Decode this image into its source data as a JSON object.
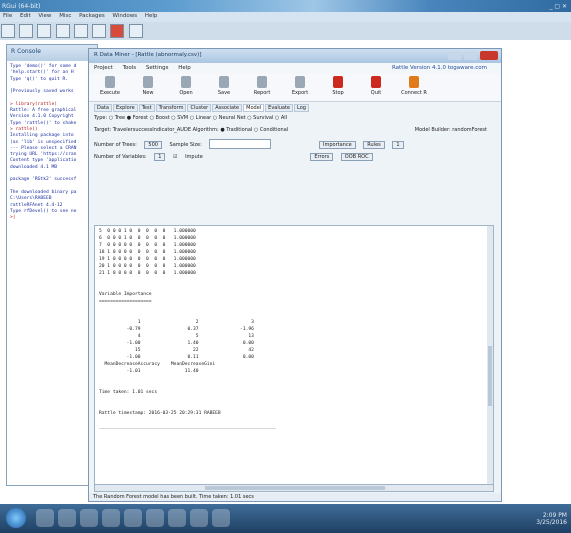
{
  "app": {
    "title": "RGui (64-bit)",
    "menubar": [
      "File",
      "Edit",
      "View",
      "Misc",
      "Packages",
      "Windows",
      "Help"
    ]
  },
  "console": {
    "header": "R Console",
    "lines": [
      {
        "text": "Type 'demo()' for some d",
        "cls": ""
      },
      {
        "text": "'help.start()' for an H",
        "cls": ""
      },
      {
        "text": "Type 'q()' to quit R.",
        "cls": ""
      },
      {
        "text": "",
        "cls": ""
      },
      {
        "text": "[Previously saved works",
        "cls": ""
      },
      {
        "text": "",
        "cls": ""
      },
      {
        "text": "> library(rattle)",
        "cls": "red"
      },
      {
        "text": "Rattle: A free graphical",
        "cls": ""
      },
      {
        "text": "Version 4.1.0 Copyright",
        "cls": ""
      },
      {
        "text": "Type 'rattle()' to shake",
        "cls": ""
      },
      {
        "text": "> rattle()",
        "cls": "red"
      },
      {
        "text": "Installing package into",
        "cls": ""
      },
      {
        "text": "(as 'lib' is unspecified",
        "cls": ""
      },
      {
        "text": "--- Please select a CRAN",
        "cls": ""
      },
      {
        "text": "trying URL 'https://cran",
        "cls": ""
      },
      {
        "text": "Content type 'applicatio",
        "cls": ""
      },
      {
        "text": "downloaded 4.1 MB",
        "cls": ""
      },
      {
        "text": "",
        "cls": ""
      },
      {
        "text": "package 'RGtk2' successf",
        "cls": ""
      },
      {
        "text": "",
        "cls": ""
      },
      {
        "text": "The downloaded binary pa",
        "cls": ""
      },
      {
        "text": "        C:\\Users\\RABEEB",
        "cls": ""
      },
      {
        "text": "rattleRFAnet 4.4-12",
        "cls": ""
      },
      {
        "text": "Type rfDevel() to see ne",
        "cls": ""
      },
      {
        "text": ">|",
        "cls": "red"
      }
    ]
  },
  "rattle": {
    "title": "R Data Miner - [Rattle (abnormaly.csv)]",
    "menu": [
      "Project",
      "Tools",
      "Settings",
      "Help"
    ],
    "version_link": "Rattle Version 4.1.0 togaware.com",
    "toolbar": [
      {
        "label": "Execute",
        "icon": "gear-icon",
        "color": "#9aa8b6"
      },
      {
        "label": "New",
        "icon": "new-file-icon",
        "color": "#9aa8b6"
      },
      {
        "label": "Open",
        "icon": "open-folder-icon",
        "color": "#9aa8b6"
      },
      {
        "label": "Save",
        "icon": "save-icon",
        "color": "#9aa8b6"
      },
      {
        "label": "Report",
        "icon": "report-icon",
        "color": "#9aa8b6"
      },
      {
        "label": "Export",
        "icon": "export-icon",
        "color": "#9aa8b6"
      },
      {
        "label": "Stop",
        "icon": "stop-icon",
        "color": "#cc2a1f"
      },
      {
        "label": "Quit",
        "icon": "quit-icon",
        "color": "#cc2a1f"
      },
      {
        "label": "Connect R",
        "icon": "connect-icon",
        "color": "#e07a1a"
      }
    ],
    "tabs": [
      "Data",
      "Explore",
      "Test",
      "Transform",
      "Cluster",
      "Associate",
      "Model",
      "Evaluate",
      "Log"
    ],
    "active_tab": "Model",
    "type_row": "Type: ○ Tree  ● Forest  ○ Boost  ○ SVM  ○ Linear  ○ Neural Net  ○ Survival  ○ All",
    "target_row": "Target: TravelersuccessIndicator_AUDE    Algorithm:  ● Traditional  ○ Conditional",
    "model_builder": "Model Builder:  randomForest",
    "trees_label": "Number of Trees:",
    "trees_value": "500",
    "sample_label": "Sample Size:",
    "importance_btn": "Importance",
    "rules_btn": "Rules",
    "rules_value": "1",
    "vars_label": "Number of Variables:",
    "vars_value": "1",
    "impute_label": "Impute",
    "errors_btn": "Errors",
    "oobroc_btn": "OOB ROC",
    "output_lines": [
      "5  0 0 0 1 0  0  0  0  0   1.000000",
      "6  0 0 0 1 0  0  0  0  0   1.000000",
      "7  0 0 0 0 0  0  0  0  0   1.000000",
      "18 1 0 0 0 0  0  0  0  0   1.000000",
      "19 1 0 0 0 0  0  0  0  0   1.000000",
      "20 1 0 0 0 0  0  0  0  0   1.000000",
      "21 1 0 0 0 0  0  0  0  0   1.000000",
      "",
      "",
      "Variable Importance",
      "===================",
      "",
      "",
      "              1                    2                   3",
      "          -0.79                 0.37               -1.96",
      "              4                    5                  13",
      "          -1.00                 1.40                0.00",
      "             15                   22                  42",
      "          -1.00                 0.11                0.00",
      "  MeanDecreaseAccuracy    MeanDecreaseGini",
      "          -1.01                11.40",
      "",
      "",
      "Time taken: 1.01 secs",
      "",
      "",
      "Rattle timestamp: 2016-03-25 20:29:31 RABEEB",
      "",
      "________________________________________________________________"
    ],
    "status": "The Random Forest model has been built. Time taken: 1.01 secs"
  },
  "taskbar": {
    "tray_time": "2:09 PM",
    "tray_date": "3/25/2016"
  }
}
